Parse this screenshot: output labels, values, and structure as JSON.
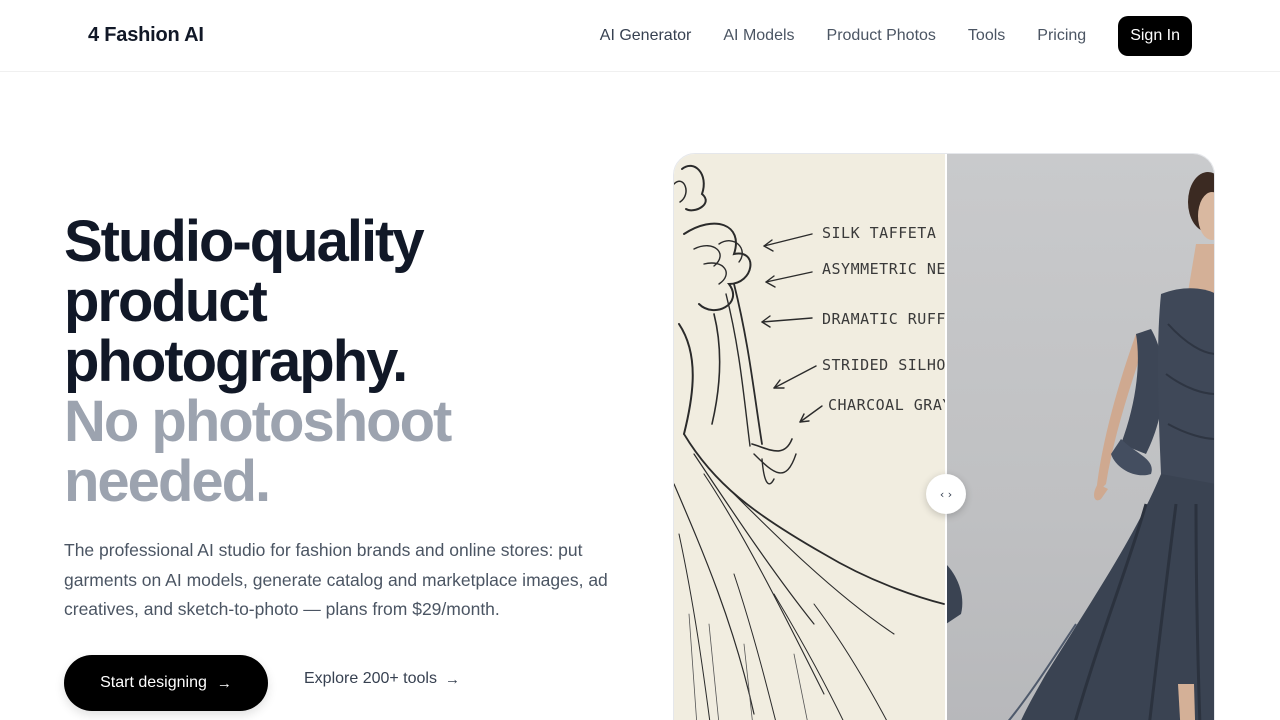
{
  "header": {
    "logo": "4 Fashion AI",
    "nav": [
      "AI Generator",
      "AI Models",
      "Product Photos",
      "Tools",
      "Pricing"
    ],
    "signin": "Sign In"
  },
  "hero": {
    "headline_dark": [
      "Studio-quality",
      "product",
      "photography."
    ],
    "headline_muted": [
      "No photoshoot",
      "needed."
    ],
    "subtext": "The professional AI studio for fashion brands and online stores: put garments on AI models, generate catalog and marketplace images, ad creatives, and sketch-to-photo — plans from $29/month.",
    "primary_cta": "Start designing",
    "secondary_cta": "Explore 200+ tools"
  },
  "compare": {
    "annotations": [
      "SILK TAFFETA",
      "ASYMMETRIC NE",
      "DRAMATIC RUFF",
      "STRIDED SILHOU",
      "CHARCOAL GRAY"
    ],
    "handle_glyph": "‹ ›"
  },
  "icons": {
    "arrow": "→"
  },
  "colors": {
    "primary": "#000000",
    "headline": "#111827",
    "headline_muted": "#9ca3af",
    "body_text": "#4b5563",
    "sketch_paper": "#f1ede0",
    "photo_bg": "#c4c5c7"
  }
}
